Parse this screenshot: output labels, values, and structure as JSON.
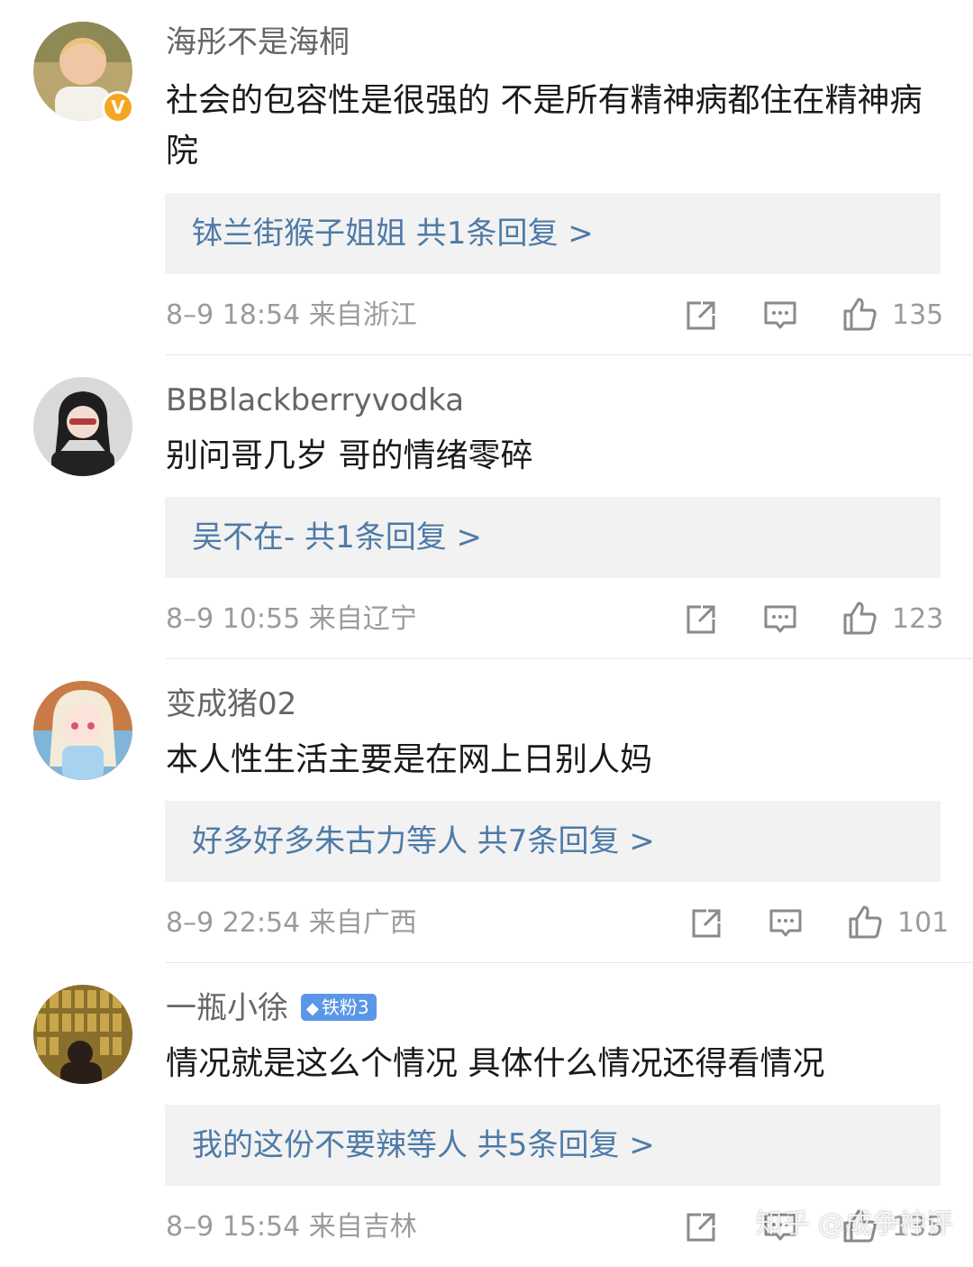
{
  "comments": [
    {
      "username": "海彤不是海桐",
      "verified_badge": "V",
      "text": "社会的包容性是很强的 不是所有精神病都住在精神病院",
      "reply_summary": "钵兰街猴子姐姐  共1条回复 >",
      "datetime": "8–9 18:54",
      "location": "来自浙江",
      "likes": "135"
    },
    {
      "username": "BBBlackberryvodka",
      "text": "别问哥几岁 哥的情绪零碎",
      "reply_summary": "吴不在-  共1条回复 >",
      "datetime": "8–9 10:55",
      "location": "来自辽宁",
      "likes": "123"
    },
    {
      "username": "变成猪02",
      "text": "本人性生活主要是在网上日别人妈",
      "reply_summary": "好多好多朱古力等人  共7条回复 >",
      "datetime": "8–9 22:54",
      "location": "来自广西",
      "likes": "101"
    },
    {
      "username": "一瓶小徐",
      "fan_badge": "铁粉3",
      "text": "情况就是这么个情况 具体什么情况还得看情况",
      "reply_summary": "我的这份不要辣等人  共5条回复 >",
      "datetime": "8–9 15:54",
      "location": "来自吉林",
      "likes": "135"
    }
  ],
  "icons": {
    "share": "share-icon",
    "comment": "comment-icon",
    "like": "thumbs-up-icon",
    "fan_gem": "diamond-icon"
  },
  "watermark": "知乎 @成争神评",
  "colors": {
    "reply_link": "#4e7aa7",
    "meta": "#9b9b9b",
    "verified": "#f4a623",
    "fan_badge": "#5b97e6"
  }
}
